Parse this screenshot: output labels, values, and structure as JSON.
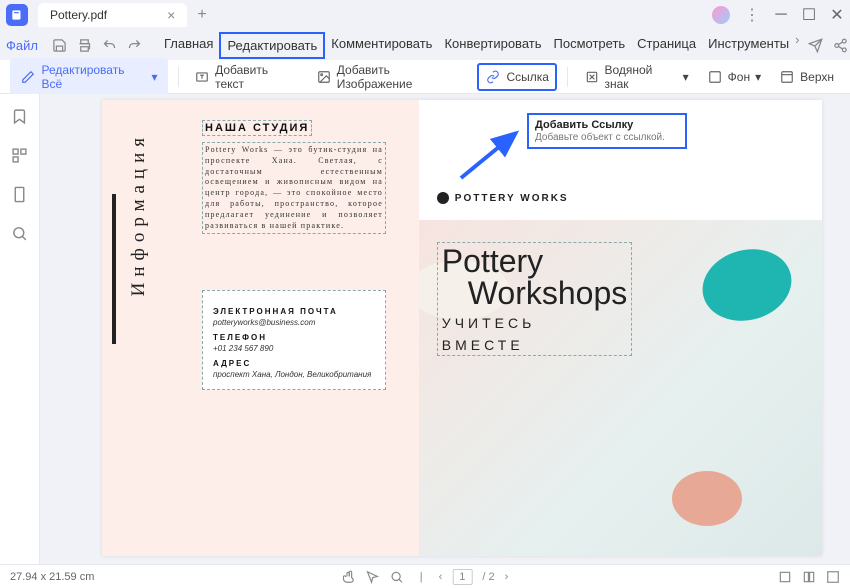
{
  "tab": {
    "title": "Pottery.pdf"
  },
  "menu": {
    "file": "Файл",
    "items": [
      "Главная",
      "Редактировать",
      "Комментировать",
      "Конвертировать",
      "Посмотреть",
      "Страница",
      "Инструменты"
    ]
  },
  "toolbar": {
    "edit_all": "Редактировать Всё",
    "add_text": "Добавить текст",
    "add_image": "Добавить Изображение",
    "link": "Ссылка",
    "watermark": "Водяной знак",
    "background": "Фон",
    "header": "Верхн"
  },
  "tooltip": {
    "title": "Добавить Ссылку",
    "body": "Добавьте объект с ссылкой."
  },
  "doc": {
    "vlabel": "Информация",
    "studio_h": "НАША СТУДИЯ",
    "studio_body": "Pottery Works — это бутик-студия на проспекте Хана. Светлая, с достаточным естественным освещением и живописным видом на центр города, — это спокойное место для работы, пространство, которое предлагает уединение и позволяет развиваться в нашей практике.",
    "email_h": "ЭЛЕКТРОННАЯ ПОЧТА",
    "email_v": "potteryworks@business.com",
    "phone_h": "ТЕЛЕФОН",
    "phone_v": "+01 234 567 890",
    "addr_h": "АДРЕС",
    "addr_v": "проспект Хана, Лондон, Великобритания",
    "brand": "POTTERY WORKS",
    "hero1": "Pottery",
    "hero2": "Workshops",
    "hero_sub1": "УЧИТЕСЬ",
    "hero_sub2": "ВМЕСТЕ"
  },
  "status": {
    "dims": "27.94 x 21.59 cm",
    "page": "1",
    "pages": "/ 2"
  }
}
